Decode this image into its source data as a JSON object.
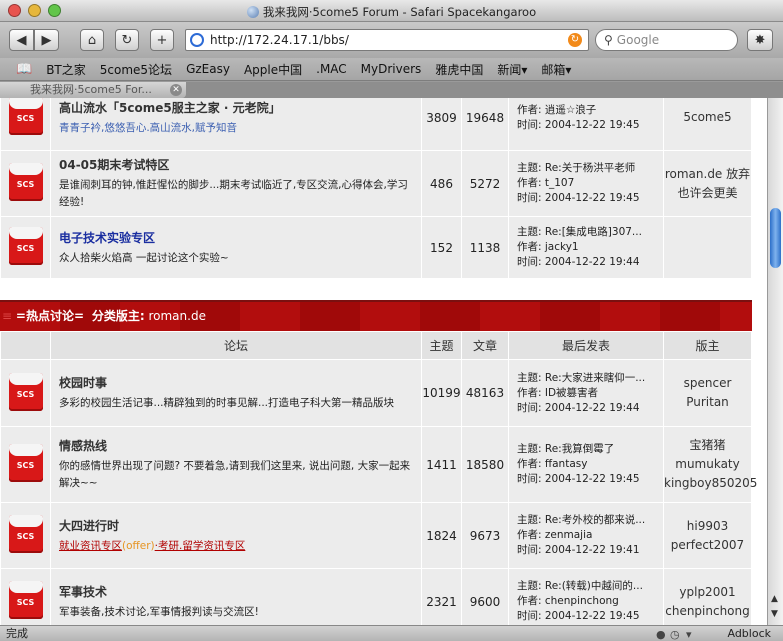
{
  "window": {
    "title": "我来我网·5come5 Forum - Safari Spacekangaroo"
  },
  "toolbar": {
    "back_label": "◀",
    "forward_label": "▶",
    "home_label": "⌂",
    "reload_label": "↻",
    "add_label": "+",
    "url": "http://172.24.17.1/bbs/",
    "search_placeholder": "Google",
    "bug_label": "✸"
  },
  "bookmarks": [
    "BT之家",
    "5come5论坛",
    "GzEasy",
    "Apple中国",
    ".MAC",
    "MyDrivers",
    "雅虎中国",
    "新闻▾",
    "邮箱▾"
  ],
  "tab": {
    "label": "我来我网·5come5 For..."
  },
  "top_forums": [
    {
      "name": "高山流水「5come5服主之家 · 元老院」",
      "desc": "青青子衿,悠悠吾心.高山流水,赋予知音",
      "desc_color": "blue",
      "topics": "3809",
      "posts": "19648",
      "last": {
        "topic": "",
        "author": "作者: 逍遥☆浪子",
        "time": "时间: 2004-12-22 19:45"
      },
      "mods": [
        "5come5"
      ]
    },
    {
      "name": "04-05期末考试特区",
      "desc": "是谁闹刺耳的钟,惟赶惺忪的脚步...期末考试临近了,专区交流,心得体会,学习经验!",
      "topics": "486",
      "posts": "5272",
      "last": {
        "topic": "主题: Re:关于杨洪平老师",
        "author": "作者: t_107",
        "time": "时间: 2004-12-22 19:45"
      },
      "mods": [
        "roman.de 放弃也许会更美"
      ]
    },
    {
      "name": "电子技术实验专区",
      "desc": "众人拾柴火焰高 一起讨论这个实验~",
      "topics": "152",
      "posts": "1138",
      "last": {
        "topic": "主题: Re:[集成电路]307...",
        "author": "作者: jacky1",
        "time": "时间: 2004-12-22 19:44"
      },
      "mods": []
    }
  ],
  "section": {
    "title": "=热点讨论=",
    "mod_label": "分类版主:",
    "mod_name": "roman.de"
  },
  "table_headers": {
    "forum": "论坛",
    "topics": "主题",
    "posts": "文章",
    "last": "最后发表",
    "mods": "版主"
  },
  "hot_forums": [
    {
      "name": "校园时事",
      "desc": "多彩的校园生活记事...精辟独到的时事见解...打造电子科大第一精品版块",
      "topics": "10199",
      "posts": "48163",
      "last": {
        "topic": "主题: Re:大家进来瞎仰一...",
        "author": "作者: ID被篡害者",
        "time": "时间: 2004-12-22 19:44"
      },
      "mods": [
        "spencer",
        "Puritan"
      ]
    },
    {
      "name": "情感热线",
      "desc": "你的感情世界出现了问题? 不要着急,请到我们这里来, 说出问题, 大家一起来解决~~",
      "topics": "1411",
      "posts": "18580",
      "last": {
        "topic": "主题: Re:我算倒霉了",
        "author": "作者: ffantasy",
        "time": "时间: 2004-12-22 19:45"
      },
      "mods": [
        "宝猪猪",
        "mumukaty",
        "kingboy850205"
      ]
    },
    {
      "name": "大四进行时",
      "desc_parts": [
        "就业资讯专区",
        "(offer)",
        "·考研.留学资讯专区"
      ],
      "topics": "1824",
      "posts": "9673",
      "last": {
        "topic": "主题: Re:考外校的都来说...",
        "author": "作者: zenmajia",
        "time": "时间: 2004-12-22 19:41"
      },
      "mods": [
        "hi9903",
        "perfect2007"
      ]
    },
    {
      "name": "军事技术",
      "desc": "军事装备,技术讨论,军事情报判读与交流区!",
      "topics": "2321",
      "posts": "9600",
      "last": {
        "topic": "主题: Re:(转载)中越间的...",
        "author": "作者: chenpinchong",
        "time": "时间: 2004-12-22 19:45"
      },
      "mods": [
        "yplp2001",
        "chenpinchong"
      ]
    }
  ],
  "icon_text": "SCS",
  "status": {
    "left": "完成",
    "right": "Adblock"
  },
  "colors": {
    "section_red": "#b20d0d",
    "forum_blue": "#1a2ea0",
    "link_red": "#b10000"
  }
}
